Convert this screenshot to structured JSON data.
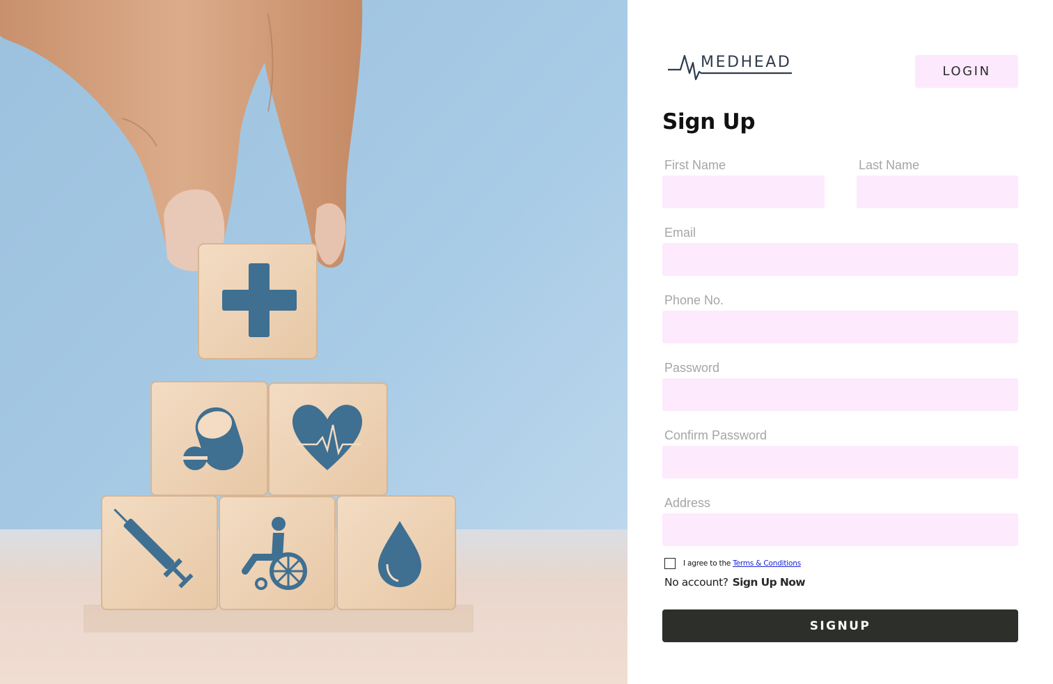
{
  "brand": {
    "name": "MEDHEAD"
  },
  "header": {
    "login_label": "LOGIN"
  },
  "form": {
    "title": "Sign Up",
    "fields": {
      "first_name": {
        "label": "First Name",
        "value": ""
      },
      "last_name": {
        "label": "Last Name",
        "value": ""
      },
      "email": {
        "label": "Email",
        "value": ""
      },
      "phone": {
        "label": "Phone No.",
        "value": ""
      },
      "password": {
        "label": "Password",
        "value": ""
      },
      "confirm_password": {
        "label": "Confirm Password",
        "value": ""
      },
      "address": {
        "label": "Address",
        "value": ""
      }
    },
    "agree": {
      "text": "I agree to the",
      "link": "Terms & Conditions",
      "checked": false
    },
    "no_account": {
      "text": "No account?",
      "link": "Sign Up Now"
    },
    "submit_label": "SIGNUP"
  },
  "colors": {
    "input_bg": "#fdeafd",
    "button_dark": "#2c2f2a",
    "brand_navy": "#2f3b4c",
    "icon_blue": "#3f6f91",
    "link_blue": "#1a24d6"
  },
  "hero": {
    "icons": [
      "plus-icon",
      "pill-icon",
      "heart-pulse-icon",
      "syringe-icon",
      "wheelchair-icon",
      "blood-drop-icon"
    ]
  }
}
